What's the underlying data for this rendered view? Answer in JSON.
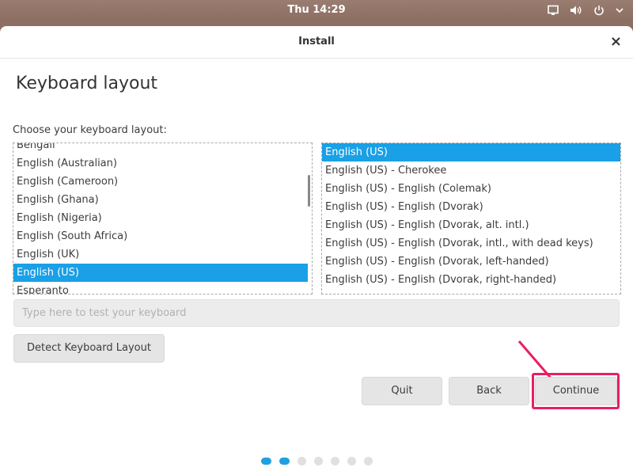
{
  "topbar": {
    "clock": "Thu 14:29",
    "tray_icons": [
      "screen-icon",
      "volume-icon",
      "power-icon",
      "chevron-down-icon"
    ]
  },
  "window": {
    "title": "Install",
    "close_label": "×"
  },
  "page": {
    "heading": "Keyboard layout",
    "choose_label": "Choose your keyboard layout:"
  },
  "layouts": {
    "partial_top": "Bengali",
    "items": [
      "English (Australian)",
      "English (Cameroon)",
      "English (Ghana)",
      "English (Nigeria)",
      "English (South Africa)",
      "English (UK)",
      "English (US)",
      "Esperanto"
    ],
    "selected": "English (US)"
  },
  "variants": {
    "items": [
      "English (US)",
      "English (US) - Cherokee",
      "English (US) - English (Colemak)",
      "English (US) - English (Dvorak)",
      "English (US) - English (Dvorak, alt. intl.)",
      "English (US) - English (Dvorak, intl., with dead keys)",
      "English (US) - English (Dvorak, left-handed)",
      "English (US) - English (Dvorak, right-handed)"
    ],
    "selected": "English (US)"
  },
  "test_field": {
    "placeholder": "Type here to test your keyboard",
    "value": ""
  },
  "buttons": {
    "detect": "Detect Keyboard Layout",
    "quit": "Quit",
    "back": "Back",
    "continue": "Continue"
  },
  "progress": {
    "total_steps": 7,
    "current_step": 2
  },
  "colors": {
    "accent": "#19a0e6",
    "highlight": "#e91e63",
    "topbar": "#8d6f63"
  }
}
